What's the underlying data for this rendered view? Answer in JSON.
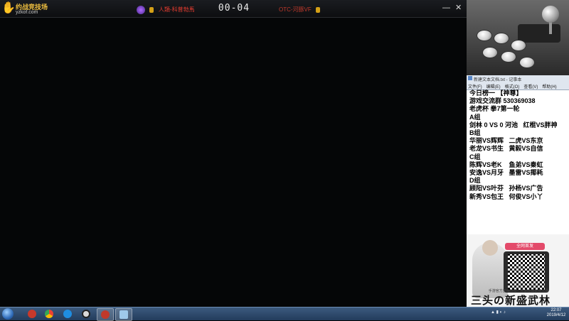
{
  "topbar": {
    "logo_text": "约战竞技场",
    "logo_url": "yzkof.com",
    "team_left": "人類-科普勃馬",
    "score": "00-04",
    "team_right": "OTC-河豚VF",
    "minimize": "—",
    "close": "✕"
  },
  "notepad": {
    "title": "新建文本文档.txt - 记事本",
    "menu": [
      "文件(F)",
      "编辑(E)",
      "格式(O)",
      "查看(V)",
      "帮助(H)"
    ]
  },
  "schedule": {
    "lines": [
      "今日榜一 【神尊】",
      "游戏交流群 530369038",
      "老虎杯 拳7第一轮",
      "A组",
      "剑林 0 VS 0 河池   红棍VS胖神",
      "",
      "B组",
      "华丽VS辉辉   二虎VS东京",
      "老龙VS书生   黄毅VS自信",
      "C组",
      "陈辉VS老K    鱼弟VS秦虹",
      "安逸VS月牙   墨雷VS揶耗",
      "D组",
      "顾阳VS叶芬   孙杨VS广告",
      "新秀VS包王   何俊VS小丫"
    ]
  },
  "promo": {
    "tag": "全网首发",
    "small_text": "手游官方正版授权 · 传承经典武侠江湖",
    "title": "三头の新盛武林"
  },
  "taskbar": {
    "clock_time": "22:07",
    "clock_date": "2019/4/12"
  },
  "colors": {
    "video_bg": "#050607",
    "team_red": "#e23b2f",
    "taskbar": "#2d4a6e"
  }
}
